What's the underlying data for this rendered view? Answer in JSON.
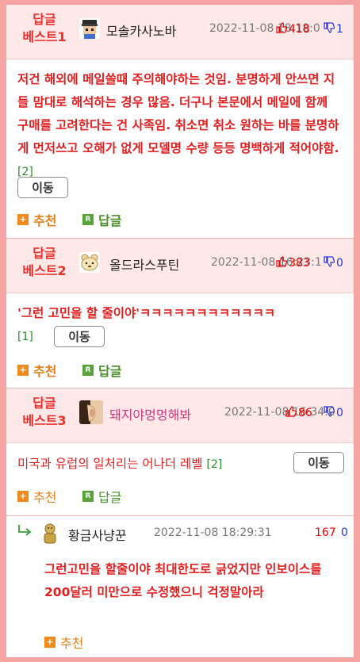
{
  "best1": {
    "rank": "답글\n베스트1",
    "nick": "모솔카사노바",
    "date": "2022-11-08 18:18:0",
    "likes": "418",
    "dislikes": "1",
    "text": "저건 해외에 메일쓸때 주의해야하는 것임. 분명하게 안쓰면 지들 맘대로 해석하는 경우 많음. 더구나 본문에서 메일에 함께 구매를 고려한다는 건 사족임. 취소면 취소 원하는 바를 분명하게 먼저쓰고 오해가 없게 모델명 수량 등등 명백하게 적어야함.",
    "ref": "[2]",
    "move": "이동",
    "recommend": "추천",
    "reply": "답글"
  },
  "best2": {
    "rank": "답글\n베스트2",
    "nick": "올드라스푸틴",
    "date": "2022-11-08 16:23:1",
    "likes": "383",
    "dislikes": "0",
    "text": "'그런 고민을 할 줄이야'ㅋㅋㅋㅋㅋㅋㅋㅋㅋㅋㅋㅋ",
    "ref": "[1]",
    "move": "이동",
    "recommend": "추천",
    "reply": "답글"
  },
  "best3": {
    "rank": "답글\n베스트3",
    "nick": "돼지야멍멍해봐",
    "date": "2022-11-08 16:34:0",
    "likes": "86",
    "dislikes": "0",
    "text": "미국과 유럽의 일처리는 어나더 레벨",
    "ref": "[2]",
    "move": "이동",
    "recommend": "추천",
    "reply": "답글"
  },
  "reply": {
    "nick": "황금사냥꾼",
    "date": "2022-11-08 18:29:31",
    "likes": "167",
    "dislikes": "0",
    "text": "그런고민을 할줄이야 최대한도로 긁었지만 인보이스를 200달러 미만으로 수정했으니 걱정말아라",
    "recommend": "추천"
  }
}
